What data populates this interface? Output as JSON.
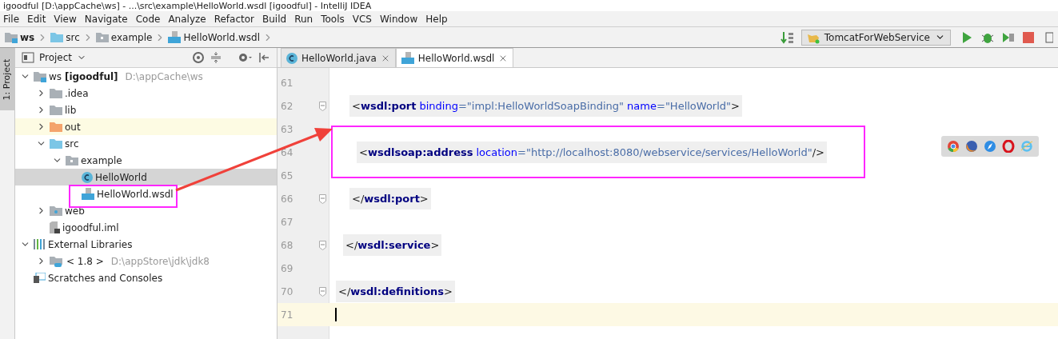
{
  "window": {
    "title": "igoodful [D:\\appCache\\ws] - ...\\src\\example\\HelloWorld.wsdl [igoodful] - IntelliJ IDEA"
  },
  "menu": [
    "File",
    "Edit",
    "View",
    "Navigate",
    "Code",
    "Analyze",
    "Refactor",
    "Build",
    "Run",
    "Tools",
    "VCS",
    "Window",
    "Help"
  ],
  "breadcrumbs": [
    {
      "label": "ws",
      "kind": "module"
    },
    {
      "label": "src",
      "kind": "folder-source"
    },
    {
      "label": "example",
      "kind": "package"
    },
    {
      "label": "HelloWorld.wsdl",
      "kind": "wsdl"
    }
  ],
  "run_configuration": {
    "label": "TomcatForWebService"
  },
  "side_strip": {
    "tab": "1: Project"
  },
  "project_panel": {
    "title": "Project",
    "tree": [
      {
        "label": "ws **[igoodful]**",
        "hint": "D:\\appCache\\ws",
        "kind": "module",
        "expanded": true,
        "selected": false,
        "highlighted": false,
        "children": [
          {
            "label": ".idea",
            "kind": "folder",
            "expanded": false,
            "selected": false,
            "highlighted": false
          },
          {
            "label": "lib",
            "kind": "folder",
            "expanded": false,
            "selected": false,
            "highlighted": false
          },
          {
            "label": "out",
            "kind": "folder-excluded",
            "expanded": false,
            "selected": false,
            "highlighted": true
          },
          {
            "label": "src",
            "kind": "folder-source",
            "expanded": true,
            "selected": false,
            "highlighted": false,
            "children": [
              {
                "label": "example",
                "kind": "package",
                "expanded": true,
                "selected": false,
                "highlighted": false,
                "children": [
                  {
                    "label": "HelloWorld",
                    "kind": "class",
                    "selected": true,
                    "highlighted": false
                  },
                  {
                    "label": "HelloWorld.wsdl",
                    "kind": "wsdl",
                    "selected": false,
                    "highlighted": false
                  }
                ]
              }
            ]
          },
          {
            "label": "web",
            "kind": "folder-web",
            "expanded": false,
            "selected": false,
            "highlighted": false
          },
          {
            "label": "igoodful.iml",
            "kind": "iml",
            "selected": false,
            "highlighted": false
          }
        ]
      },
      {
        "label": "External Libraries",
        "kind": "libraries",
        "expanded": true,
        "selected": false,
        "highlighted": false,
        "children": [
          {
            "label": "< 1.8 >",
            "hint": "D:\\appStore\\jdk\\jdk8",
            "kind": "jdk",
            "expanded": false,
            "selected": false,
            "highlighted": false
          }
        ]
      },
      {
        "label": "Scratches and Consoles",
        "kind": "scratches",
        "selected": false,
        "highlighted": false
      }
    ]
  },
  "tabs": [
    {
      "label": "HelloWorld.java",
      "kind": "class",
      "selected": false
    },
    {
      "label": "HelloWorld.wsdl",
      "kind": "wsdl",
      "selected": true
    }
  ],
  "code_lines": [
    {
      "number": "61",
      "current": false,
      "fold_marker": false
    },
    {
      "number": "62",
      "current": false,
      "fold_marker": true,
      "tokens": [
        {
          "kind": "punct",
          "text": "<"
        },
        {
          "kind": "tag",
          "text": "wsdl:port"
        },
        {
          "kind": "attr",
          "text": "binding"
        },
        {
          "kind": "eq",
          "text": "="
        },
        {
          "kind": "value",
          "text": "\"impl:HelloWorldSoapBinding\""
        },
        {
          "kind": "attr",
          "text": "name"
        },
        {
          "kind": "eq",
          "text": "="
        },
        {
          "kind": "value",
          "text": "\"HelloWorld\""
        },
        {
          "kind": "punct",
          "text": ">"
        }
      ]
    },
    {
      "number": "63",
      "current": false,
      "fold_marker": false
    },
    {
      "number": "64",
      "current": false,
      "fold_marker": false,
      "tokens": [
        {
          "kind": "punct",
          "text": "<"
        },
        {
          "kind": "tag",
          "text": "wsdlsoap:address"
        },
        {
          "kind": "attr",
          "text": "location"
        },
        {
          "kind": "eq",
          "text": "="
        },
        {
          "kind": "value",
          "text": "\"http://localhost:8080/webservice/services/HelloWorld\""
        },
        {
          "kind": "punct",
          "text": "/>"
        }
      ]
    },
    {
      "number": "65",
      "current": false,
      "fold_marker": false
    },
    {
      "number": "66",
      "current": false,
      "fold_marker": true,
      "tokens": [
        {
          "kind": "punct",
          "text": "</"
        },
        {
          "kind": "tag",
          "text": "wsdl:port"
        },
        {
          "kind": "punct",
          "text": ">"
        }
      ]
    },
    {
      "number": "67",
      "current": false,
      "fold_marker": false
    },
    {
      "number": "68",
      "current": false,
      "fold_marker": true,
      "tokens": [
        {
          "kind": "punct",
          "text": "</"
        },
        {
          "kind": "tag",
          "text": "wsdl:service"
        },
        {
          "kind": "punct",
          "text": ">"
        }
      ]
    },
    {
      "number": "69",
      "current": false,
      "fold_marker": false
    },
    {
      "number": "70",
      "current": false,
      "fold_marker": true,
      "tokens": [
        {
          "kind": "punct",
          "text": "</"
        },
        {
          "kind": "tag",
          "text": "wsdl:definitions"
        },
        {
          "kind": "punct",
          "text": ">"
        }
      ]
    },
    {
      "number": "71",
      "current": true,
      "fold_marker": false
    }
  ]
}
